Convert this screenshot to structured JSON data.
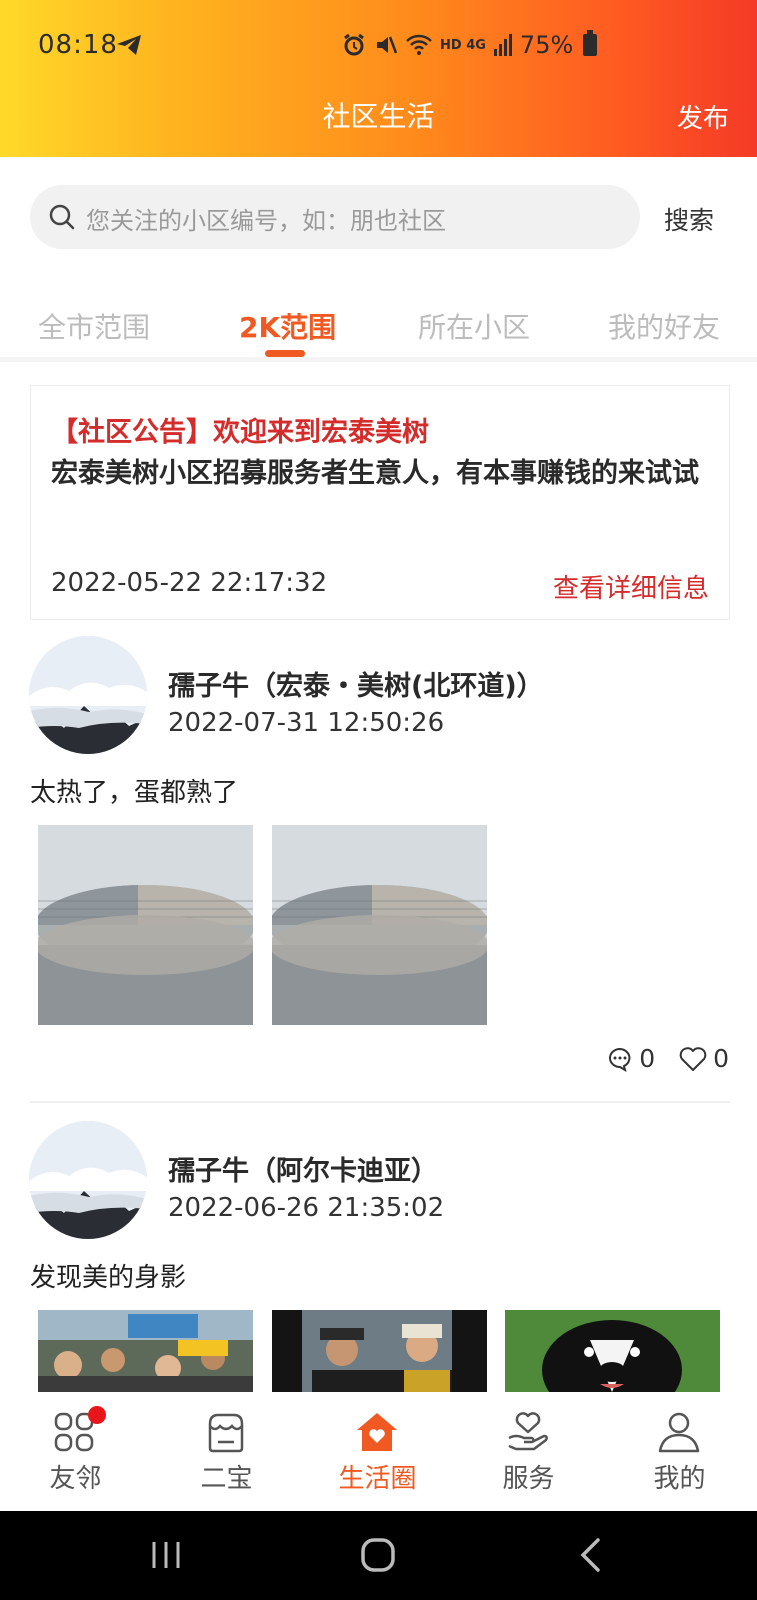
{
  "status_bar": {
    "time": "08:18",
    "network": "HD 4G",
    "battery": "75%"
  },
  "header": {
    "title": "社区生活",
    "publish_label": "发布"
  },
  "search": {
    "placeholder": "您关注的小区编号，如：朋也社区",
    "button_label": "搜索"
  },
  "tabs": [
    {
      "label": "全市范围",
      "active": false
    },
    {
      "label": "2K范围",
      "active": true
    },
    {
      "label": "所在小区",
      "active": false
    },
    {
      "label": "我的好友",
      "active": false
    }
  ],
  "notice": {
    "title": "【社区公告】欢迎来到宏泰美树",
    "body": "宏泰美树小区招募服务者生意人，有本事赚钱的来试试",
    "date": "2022-05-22 22:17:32",
    "link_label": "查看详细信息"
  },
  "posts": [
    {
      "author": "孺子牛（宏泰・美树(北环道)）",
      "date": "2022-07-31 12:50:26",
      "text": "太热了，蛋都熟了",
      "comments": "0",
      "likes": "0"
    },
    {
      "author": "孺子牛（阿尔卡迪亚）",
      "date": "2022-06-26 21:35:02",
      "text": "发现美的身影"
    }
  ],
  "bottom_nav": [
    {
      "label": "友邻",
      "icon": "grid-icon",
      "badge": true
    },
    {
      "label": "二宝",
      "icon": "shop-icon"
    },
    {
      "label": "生活圈",
      "icon": "home-heart-icon",
      "active": true
    },
    {
      "label": "服务",
      "icon": "hand-heart-icon"
    },
    {
      "label": "我的",
      "icon": "user-icon"
    }
  ],
  "colors": {
    "accent": "#f05a22",
    "notice_red": "#d42b2b",
    "badge": "#e8161b"
  }
}
